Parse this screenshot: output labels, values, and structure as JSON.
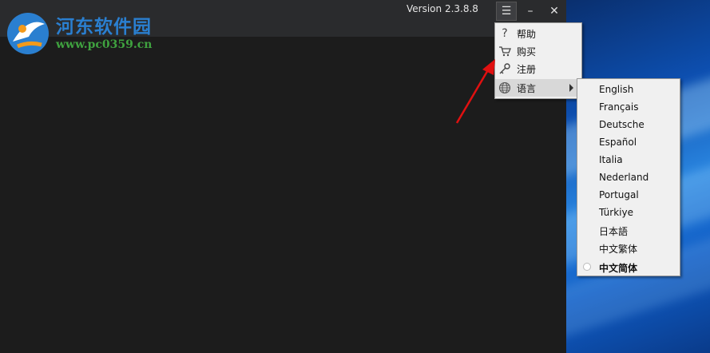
{
  "window": {
    "version": "Version 2.3.8.8",
    "menu_icon": "☰",
    "minimize_icon": "–",
    "close_icon": "✕"
  },
  "watermark": {
    "title": "河东软件园",
    "url": "www.pc0359.cn"
  },
  "main_menu": {
    "items": [
      {
        "label": "帮助",
        "icon": "help-icon"
      },
      {
        "label": "购买",
        "icon": "cart-icon"
      },
      {
        "label": "注册",
        "icon": "key-icon"
      },
      {
        "label": "语言",
        "icon": "globe-icon",
        "has_submenu": true
      }
    ]
  },
  "language_menu": {
    "items": [
      {
        "label": "English"
      },
      {
        "label": "Français"
      },
      {
        "label": "Deutsche"
      },
      {
        "label": "Español"
      },
      {
        "label": "Italia"
      },
      {
        "label": "Nederland"
      },
      {
        "label": "Portugal"
      },
      {
        "label": "Türkiye"
      },
      {
        "label": "日本語"
      },
      {
        "label": "中文繁体"
      },
      {
        "label": "中文简体",
        "selected": true
      }
    ]
  },
  "colors": {
    "app_bg": "#1c1c1c",
    "titlebar_bg": "#2a2b2d",
    "menu_bg": "#f0f0f0",
    "watermark_blue": "#2a7fd0",
    "watermark_green": "#3fa23f",
    "arrow_red": "#e01010"
  }
}
